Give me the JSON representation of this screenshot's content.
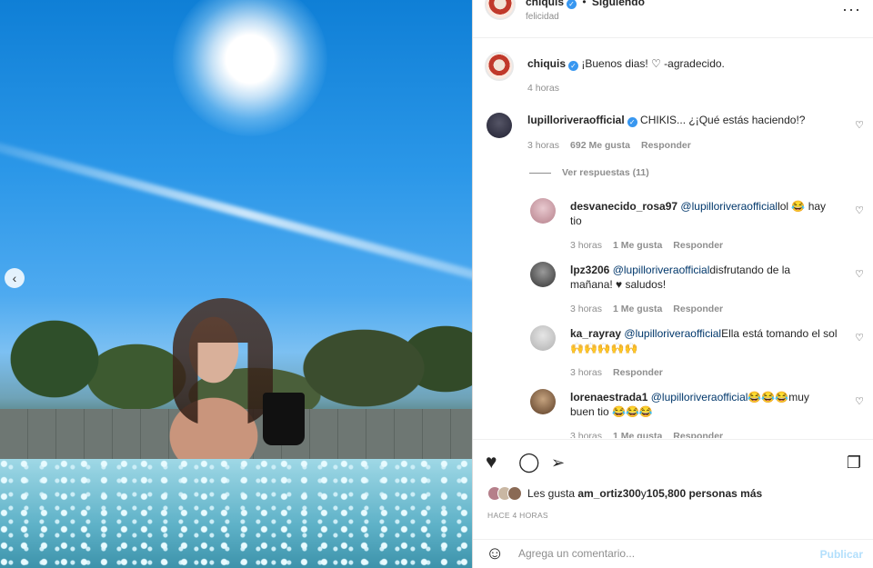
{
  "post": {
    "author": "chiquis",
    "follow_status": "Siguiendo",
    "location": "felicidad",
    "caption_user": "chiquis",
    "caption": "¡Buenos dias! ♡ -agradecido.",
    "caption_time": "4 horas"
  },
  "comments": [
    {
      "user": "lupilloriveraofficial",
      "verified": true,
      "text": "CHIKIS... ¿¡Qué estás haciendo!?",
      "time": "3 horas",
      "likes": "692 Me gusta",
      "reply": "Responder",
      "view_replies": "Ver respuestas (11)"
    },
    {
      "user": "desvanecido_rosa97",
      "mention": "@lupilloriveraofficial",
      "text": "lol 😂 hay tio",
      "time": "3 horas",
      "likes": "1 Me gusta",
      "reply": "Responder"
    },
    {
      "user": "lpz3206",
      "mention": "@lupilloriveraofficial",
      "text": "disfrutando de la mañana! ♥ saludos!",
      "time": "3 horas",
      "likes": "1 Me gusta",
      "reply": "Responder"
    },
    {
      "user": "ka_rayray",
      "mention": "@lupilloriveraofficial",
      "text": "Ella está tomando el sol 🙌🙌🙌🙌🙌",
      "time": "3 horas",
      "reply": "Responder"
    },
    {
      "user": "lorenaestrada1",
      "mention": "@lupilloriveraofficial",
      "text": "😂😂😂muy buen tio 😂😂😂",
      "time": "3 horas",
      "likes": "1 Me gusta",
      "reply": "Responder"
    }
  ],
  "likes": {
    "prefix": "Les gusta ",
    "user": "am_ortiz300",
    "middle": "y",
    "count": "105,800 personas más"
  },
  "time_ago": "HACE 4 HORAS",
  "comment_box": {
    "placeholder": "Agrega un comentario...",
    "publish": "Publicar"
  },
  "colors": {
    "liked_heart": "#ed4956",
    "link": "#00376b",
    "verified": "#3897f0",
    "publish_disabled": "#b2dffc"
  }
}
